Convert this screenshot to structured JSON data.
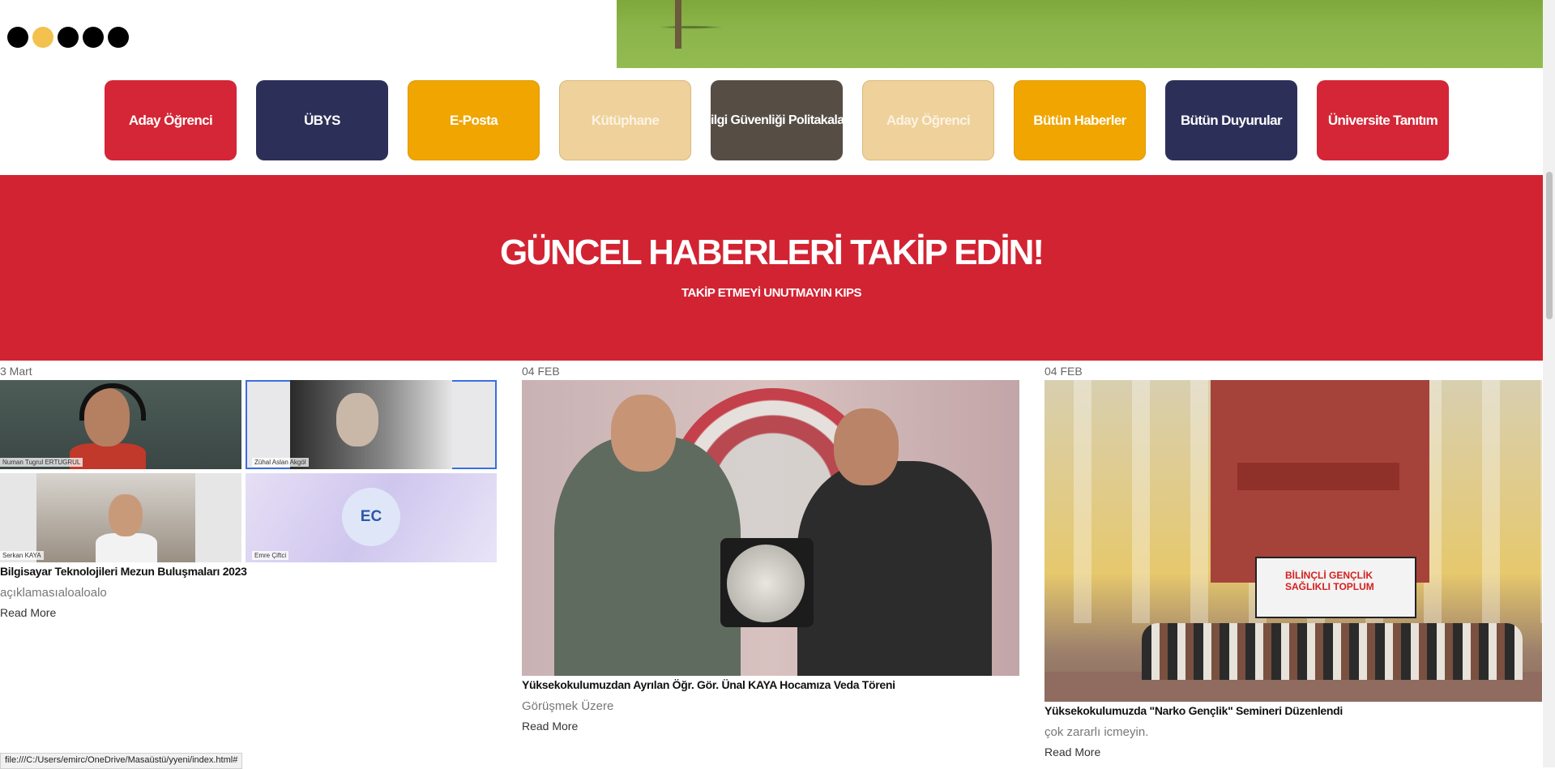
{
  "slider": {
    "dot_count": 5,
    "active_index": 1
  },
  "quick_links": [
    {
      "label": "Aday Öğrenci",
      "style": "red"
    },
    {
      "label": "ÜBYS",
      "style": "navy"
    },
    {
      "label": "E-Posta",
      "style": "gold"
    },
    {
      "label": "Kütüphane",
      "style": "beige"
    },
    {
      "label": "Bilgi Güvenliği Politakaları",
      "style": "dark"
    },
    {
      "label": "Aday Öğrenci",
      "style": "beige"
    },
    {
      "label": "Bütün Haberler",
      "style": "gold"
    },
    {
      "label": "Bütün Duyurular",
      "style": "navy"
    },
    {
      "label": "Üniversite Tanıtım",
      "style": "red"
    }
  ],
  "banner": {
    "title": "GÜNCEL HABERLERİ TAKİP EDİN!",
    "subtitle": "TAKİP ETMEYİ UNUTMAYIN KIPS",
    "color": "#d22333"
  },
  "news": [
    {
      "date": "3 Mart",
      "title": "Bilgisayar Teknolojileri Mezun Buluşmaları 2023",
      "description": "açıklamasıaloaloalo",
      "read_more": "Read More",
      "participants": [
        "Numan Tugrul ERTUGRUL",
        "Zühal Aslan Akgöl",
        "Serkan KAYA",
        "Emre Çiftci"
      ],
      "avatar_initials": "EC"
    },
    {
      "date": "04 FEB",
      "title": "Yüksekokulumuzdan Ayrılan Öğr. Gör. Ünal KAYA Hocamıza Veda Töreni",
      "description": "Görüşmek Üzere",
      "read_more": "Read More"
    },
    {
      "date": "04 FEB",
      "title": "Yüksekokulumuzda \"Narko Gençlik\" Semineri Düzenlendi",
      "description": "çok zararlı icmeyin.",
      "read_more": "Read More",
      "image_banner_text": "BİLİNÇLİ GENÇLİK SAĞLIKLI TOPLUM"
    }
  ],
  "status_url": "file:///C:/Users/emirc/OneDrive/Masaüstü/yyeni/index.html#"
}
